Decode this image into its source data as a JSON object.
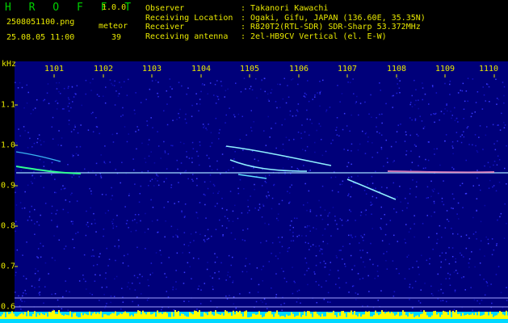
{
  "header": {
    "app_title": "H R O F F T",
    "version": "1.0.0",
    "filename": "2508051100.png",
    "timestamp": "25.08.05 11:00",
    "meteor_label": "meteor",
    "meteor_count": "39"
  },
  "station": [
    {
      "label": "Observer",
      "value": ": Takanori Kawachi"
    },
    {
      "label": "Receiving Location",
      "value": ": Ogaki, Gifu, JAPAN (136.60E, 35.35N)"
    },
    {
      "label": "Receiver",
      "value": ": R820T2(RTL-SDR) SDR-Sharp 53.372MHz"
    },
    {
      "label": "Receiving antenna",
      "value": ": 2el-HB9CV Vertical (el. E-W)"
    }
  ],
  "axes": {
    "unit": "kHz",
    "x_ticks": [
      "1101",
      "1102",
      "1103",
      "1104",
      "1105",
      "1106",
      "1107",
      "1108",
      "1109",
      "1110"
    ],
    "y_ticks": [
      "1.1",
      "1.0",
      "0.9",
      "0.8",
      "0.7",
      "0.6"
    ]
  },
  "colors": {
    "background": "#000000",
    "plot_background": "#00007a",
    "label": "#e8e800",
    "title": "#00d000",
    "meteor_trace": "#8ff0ff",
    "carrier": "#9fdcff",
    "level_bar": "#00d8ff",
    "level_peak": "#ffff00"
  }
}
